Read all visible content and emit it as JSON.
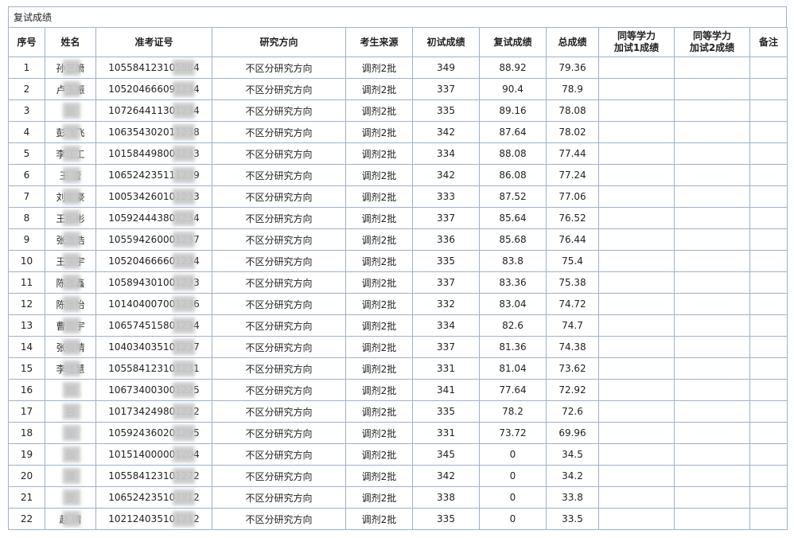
{
  "caption": "复试成绩",
  "headers": [
    "序号",
    "姓名",
    "准考证号",
    "研究方向",
    "考生来源",
    "初试成绩",
    "复试成绩",
    "总成绩",
    "同等学力\n加试1成绩",
    "同等学力\n加试2成绩",
    "备注"
  ],
  "rows": [
    {
      "no": "1",
      "name": "孙艺箫",
      "id": "105584123105884",
      "dir": "不区分研究方向",
      "src": "调剂2批",
      "init": "349",
      "re": "88.92",
      "total": "79.36"
    },
    {
      "no": "2",
      "name": "卢玉振",
      "id": "105204666091234",
      "dir": "不区分研究方向",
      "src": "调剂2批",
      "init": "337",
      "re": "90.4",
      "total": "78.9"
    },
    {
      "no": "3",
      "name": "张 ",
      "id": "107264411301234",
      "dir": "不区分研究方向",
      "src": "调剂2批",
      "init": "335",
      "re": "89.16",
      "total": "78.08"
    },
    {
      "no": "4",
      "name": "彭飞飞",
      "id": "106354302011238",
      "dir": "不区分研究方向",
      "src": "调剂2批",
      "init": "342",
      "re": "87.64",
      "total": "78.02"
    },
    {
      "no": "5",
      "name": "李江工",
      "id": "101584498001233",
      "dir": "不区分研究方向",
      "src": "调剂2批",
      "init": "334",
      "re": "88.08",
      "total": "77.44"
    },
    {
      "no": "6",
      "name": "王 蕾",
      "id": "106524235111239",
      "dir": "不区分研究方向",
      "src": "调剂2批",
      "init": "342",
      "re": "86.08",
      "total": "77.24"
    },
    {
      "no": "7",
      "name": "刘家豪",
      "id": "100534260101233",
      "dir": "不区分研究方向",
      "src": "调剂2批",
      "init": "333",
      "re": "87.52",
      "total": "77.06"
    },
    {
      "no": "8",
      "name": "王彬彬",
      "id": "105924443801234",
      "dir": "不区分研究方向",
      "src": "调剂2批",
      "init": "337",
      "re": "85.64",
      "total": "76.52"
    },
    {
      "no": "9",
      "name": "张浩浩",
      "id": "105594260001237",
      "dir": "不区分研究方向",
      "src": "调剂2批",
      "init": "336",
      "re": "85.68",
      "total": "76.44"
    },
    {
      "no": "10",
      "name": "王宇宇",
      "id": "105204666601234",
      "dir": "不区分研究方向",
      "src": "调剂2批",
      "init": "335",
      "re": "83.8",
      "total": "75.4"
    },
    {
      "no": "11",
      "name": "陈雅鑫",
      "id": "105894301001233",
      "dir": "不区分研究方向",
      "src": "调剂2批",
      "init": "337",
      "re": "83.36",
      "total": "75.38"
    },
    {
      "no": "12",
      "name": "陈怡怡",
      "id": "101404007001236",
      "dir": "不区分研究方向",
      "src": "调剂2批",
      "init": "332",
      "re": "83.04",
      "total": "74.72"
    },
    {
      "no": "13",
      "name": "曹雨宇",
      "id": "106574515801234",
      "dir": "不区分研究方向",
      "src": "调剂2批",
      "init": "334",
      "re": "82.6",
      "total": "74.7"
    },
    {
      "no": "14",
      "name": "张晓晴",
      "id": "104034035101237",
      "dir": "不区分研究方向",
      "src": "调剂2批",
      "init": "337",
      "re": "81.36",
      "total": "74.38"
    },
    {
      "no": "15",
      "name": "李佳慧",
      "id": "105584123101231",
      "dir": "不区分研究方向",
      "src": "调剂2批",
      "init": "331",
      "re": "81.04",
      "total": "73.62"
    },
    {
      "no": "16",
      "name": "郑 ",
      "id": "106734003001225",
      "dir": "不区分研究方向",
      "src": "调剂2批",
      "init": "341",
      "re": "77.64",
      "total": "72.92"
    },
    {
      "no": "17",
      "name": "吕 ",
      "id": "101734249801222",
      "dir": "不区分研究方向",
      "src": "调剂2批",
      "init": "335",
      "re": "78.2",
      "total": "72.6"
    },
    {
      "no": "18",
      "name": "张 ",
      "id": "105924360201295",
      "dir": "不区分研究方向",
      "src": "调剂2批",
      "init": "331",
      "re": "73.72",
      "total": "69.96"
    },
    {
      "no": "19",
      "name": "张 ",
      "id": "101514000001204",
      "dir": "不区分研究方向",
      "src": "调剂2批",
      "init": "345",
      "re": "0",
      "total": "34.5"
    },
    {
      "no": "20",
      "name": "谭 ",
      "id": "105584123101272",
      "dir": "不区分研究方向",
      "src": "调剂2批",
      "init": "342",
      "re": "0",
      "total": "34.2"
    },
    {
      "no": "21",
      "name": "罗 ",
      "id": "106524235101212",
      "dir": "不区分研究方向",
      "src": "调剂2批",
      "init": "338",
      "re": "0",
      "total": "33.8"
    },
    {
      "no": "22",
      "name": "赵 晴",
      "id": "102124035101212",
      "dir": "不区分研究方向",
      "src": "调剂2批",
      "init": "335",
      "re": "0",
      "total": "33.5"
    }
  ]
}
